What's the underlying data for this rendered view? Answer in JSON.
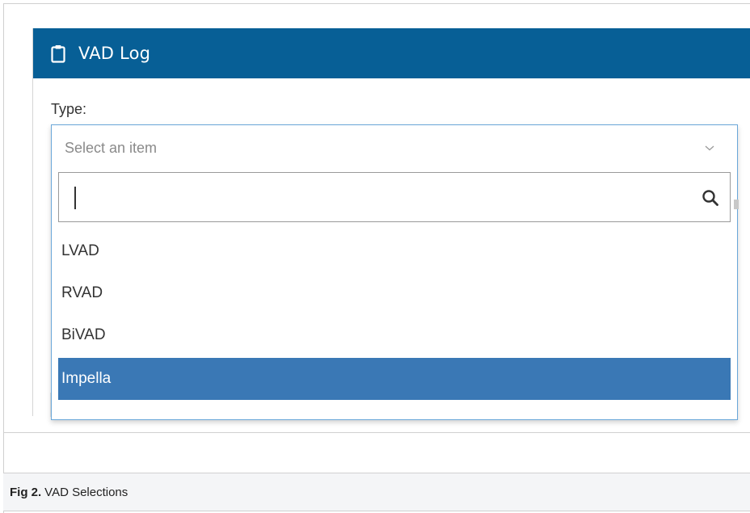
{
  "panel": {
    "title": "VAD Log",
    "icon": "clipboard-icon",
    "header_color": "#075f96"
  },
  "form": {
    "type_label": "Type:",
    "select": {
      "placeholder": "Select an item",
      "search_value": "",
      "options": [
        "LVAD",
        "RVAD",
        "BiVAD",
        "Impella"
      ],
      "highlighted_option": "Impella",
      "highlight_color": "#3a78b5"
    }
  },
  "caption": {
    "label": "Fig 2.",
    "text": "VAD Selections"
  }
}
